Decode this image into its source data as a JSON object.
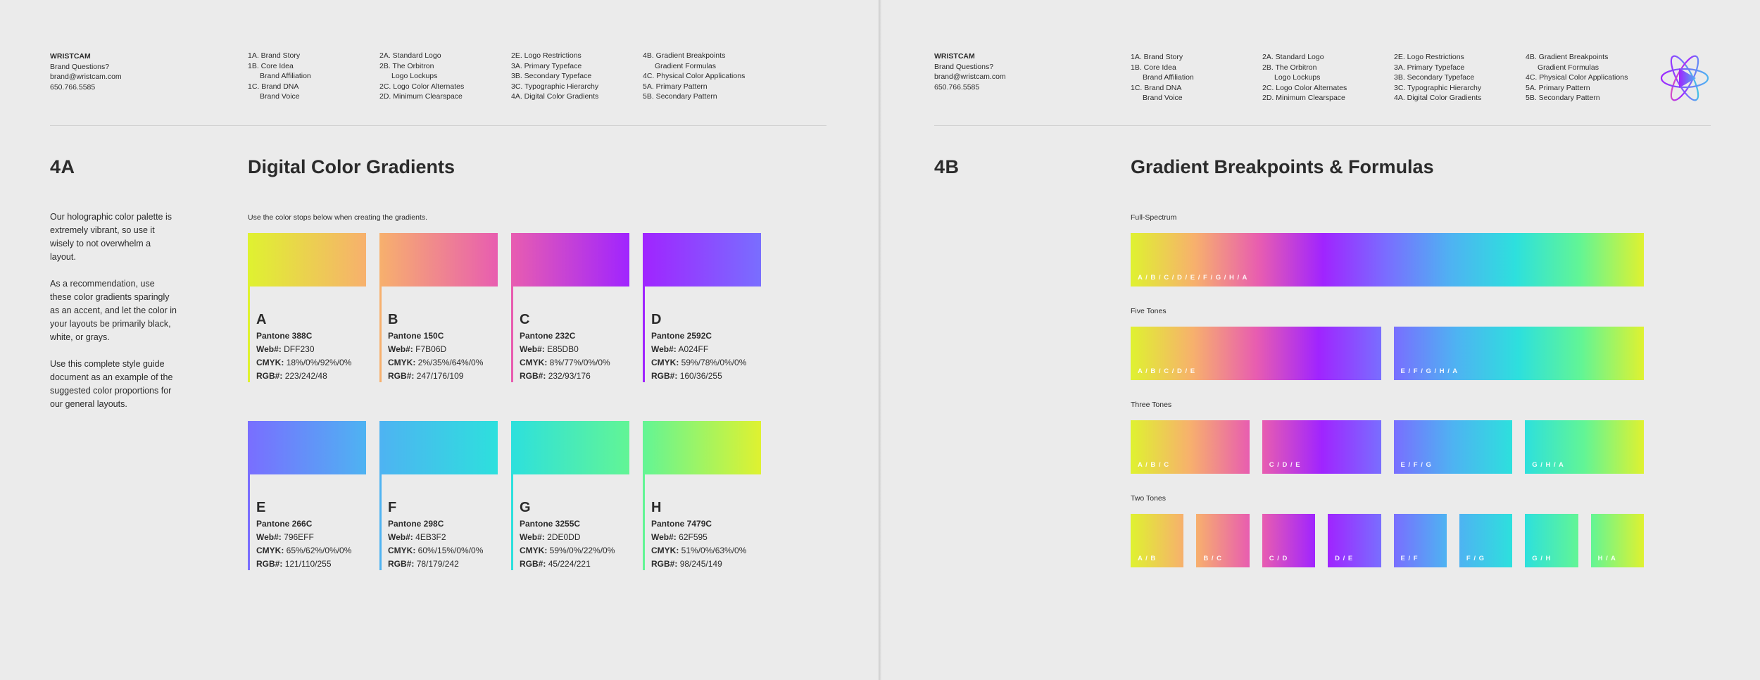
{
  "contact": {
    "brand": "WRISTCAM",
    "questions": "Brand Questions?",
    "email": "brand@wristcam.com",
    "phone": "650.766.5585"
  },
  "nav": {
    "col1": [
      "1A. Brand Story",
      "1B. Core Idea",
      "Brand Affiliation",
      "1C. Brand DNA",
      "Brand Voice"
    ],
    "col2": [
      "2A. Standard Logo",
      "2B. The Orbitron",
      "Logo Lockups",
      "2C. Logo Color Alternates",
      "2D. Minimum Clearspace"
    ],
    "col3": [
      "2E. Logo Restrictions",
      "3A. Primary Typeface",
      "3B. Secondary Typeface",
      "3C. Typographic Hierarchy",
      "4A. Digital Color Gradients"
    ],
    "col4": [
      "4B. Gradient Breakpoints",
      "Gradient Formulas",
      "4C. Physical Color Applications",
      "5A. Primary Pattern",
      "5B. Secondary Pattern"
    ]
  },
  "left": {
    "section_number": "4A",
    "section_title": "Digital Color Gradients",
    "intro": [
      "Our holographic color palette is extremely vibrant, so use it wisely to not overwhelm a layout.",
      "As a recommendation, use these color gradients sparingly as an accent, and let the color in your layouts be primarily black, white, or grays.",
      "Use this complete style guide document as an example of the suggested color proportions for our general layouts."
    ],
    "note": "Use the color stops below when creating the gradients.",
    "spec_labels": {
      "web": "Web#:",
      "cmyk": "CMYK:",
      "rgb": "RGB#:"
    },
    "colors": [
      {
        "letter": "A",
        "pantone": "Pantone 388C",
        "web": "DFF230",
        "cmyk": "18%/0%/92%/0%",
        "rgb": "223/242/48",
        "hex": "#dff230",
        "to": "#f7b06d"
      },
      {
        "letter": "B",
        "pantone": "Pantone 150C",
        "web": "F7B06D",
        "cmyk": "2%/35%/64%/0%",
        "rgb": "247/176/109",
        "hex": "#f7b06d",
        "to": "#e85db0"
      },
      {
        "letter": "C",
        "pantone": "Pantone 232C",
        "web": "E85DB0",
        "cmyk": "8%/77%/0%/0%",
        "rgb": "232/93/176",
        "hex": "#e85db0",
        "to": "#a024ff"
      },
      {
        "letter": "D",
        "pantone": "Pantone 2592C",
        "web": "A024FF",
        "cmyk": "59%/78%/0%/0%",
        "rgb": "160/36/255",
        "hex": "#a024ff",
        "to": "#796eff"
      },
      {
        "letter": "E",
        "pantone": "Pantone 266C",
        "web": "796EFF",
        "cmyk": "65%/62%/0%/0%",
        "rgb": "121/110/255",
        "hex": "#796eff",
        "to": "#4eb3f2"
      },
      {
        "letter": "F",
        "pantone": "Pantone 298C",
        "web": "4EB3F2",
        "cmyk": "60%/15%/0%/0%",
        "rgb": "78/179/242",
        "hex": "#4eb3f2",
        "to": "#2de0dd"
      },
      {
        "letter": "G",
        "pantone": "Pantone 3255C",
        "web": "2DE0DD",
        "cmyk": "59%/0%/22%/0%",
        "rgb": "45/224/221",
        "hex": "#2de0dd",
        "to": "#62f595"
      },
      {
        "letter": "H",
        "pantone": "Pantone 7479C",
        "web": "62F595",
        "cmyk": "51%/0%/63%/0%",
        "rgb": "98/245/149",
        "hex": "#62f595",
        "to": "#dff230"
      }
    ]
  },
  "right": {
    "section_number": "4B",
    "section_title": "Gradient Breakpoints & Formulas",
    "groups": [
      {
        "label": "Full-Spectrum",
        "bars": [
          {
            "label": "A / B / C / D / E / F / G / H / A",
            "stops": [
              "A",
              "B",
              "C",
              "D",
              "E",
              "F",
              "G",
              "H",
              "A"
            ]
          }
        ]
      },
      {
        "label": "Five Tones",
        "bars": [
          {
            "label": "A / B / C / D / E",
            "stops": [
              "A",
              "B",
              "C",
              "D",
              "E"
            ]
          },
          {
            "label": "E / F / G / H / A",
            "stops": [
              "E",
              "F",
              "G",
              "H",
              "A"
            ]
          }
        ]
      },
      {
        "label": "Three Tones",
        "bars": [
          {
            "label": "A / B / C",
            "stops": [
              "A",
              "B",
              "C"
            ]
          },
          {
            "label": "C / D / E",
            "stops": [
              "C",
              "D",
              "E"
            ]
          },
          {
            "label": "E / F / G",
            "stops": [
              "E",
              "F",
              "G"
            ]
          },
          {
            "label": "G / H / A",
            "stops": [
              "G",
              "H",
              "A"
            ]
          }
        ]
      },
      {
        "label": "Two Tones",
        "bars": [
          {
            "label": "A / B",
            "stops": [
              "A",
              "B"
            ]
          },
          {
            "label": "B / C",
            "stops": [
              "B",
              "C"
            ]
          },
          {
            "label": "C / D",
            "stops": [
              "C",
              "D"
            ]
          },
          {
            "label": "D / E",
            "stops": [
              "D",
              "E"
            ]
          },
          {
            "label": "E / F",
            "stops": [
              "E",
              "F"
            ]
          },
          {
            "label": "F / G",
            "stops": [
              "F",
              "G"
            ]
          },
          {
            "label": "G / H",
            "stops": [
              "G",
              "H"
            ]
          },
          {
            "label": "H / A",
            "stops": [
              "H",
              "A"
            ]
          }
        ]
      }
    ]
  },
  "logo": {
    "icon": "orbitron-logo-icon"
  }
}
